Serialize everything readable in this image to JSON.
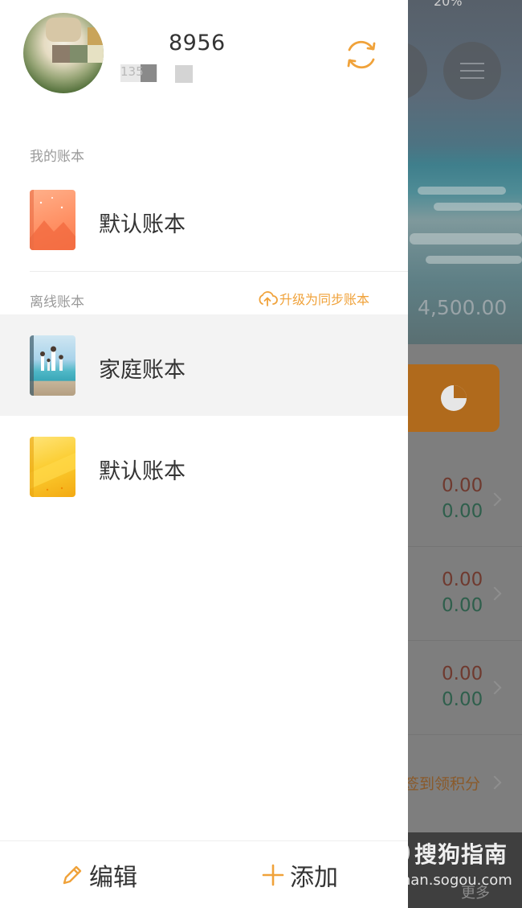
{
  "background_screen": {
    "balance": "4,500.00",
    "rows": [
      {
        "top_value": "0.00",
        "bottom_value": "0.00"
      },
      {
        "top_value": "0.00",
        "bottom_value": "0.00"
      },
      {
        "top_value": "0.00",
        "bottom_value": "0.00"
      }
    ],
    "signin_text": "签到领积分",
    "more_text": "更多",
    "status_text": "20%",
    "watermark": {
      "brand": "搜狗指南",
      "url": "zhinan.sogou.com"
    }
  },
  "drawer": {
    "user": {
      "name_visible": "8956",
      "phone_visible": "135"
    },
    "sections": {
      "my_books": "我的账本",
      "offline_books": "离线账本",
      "upgrade_label": "升级为同步账本"
    },
    "my_books": [
      {
        "name": "默认账本",
        "icon": "orange-mountain-book-icon"
      }
    ],
    "offline_books": [
      {
        "name": "家庭账本",
        "icon": "family-beach-book-icon",
        "active": true
      },
      {
        "name": "默认账本",
        "icon": "yellow-book-icon"
      }
    ],
    "bottom": {
      "edit_label": "编辑",
      "add_label": "添加"
    }
  },
  "colors": {
    "accent": "#f0a23a",
    "text": "#333333",
    "muted": "#9a9a9a",
    "active_row": "#f3f3f3"
  }
}
